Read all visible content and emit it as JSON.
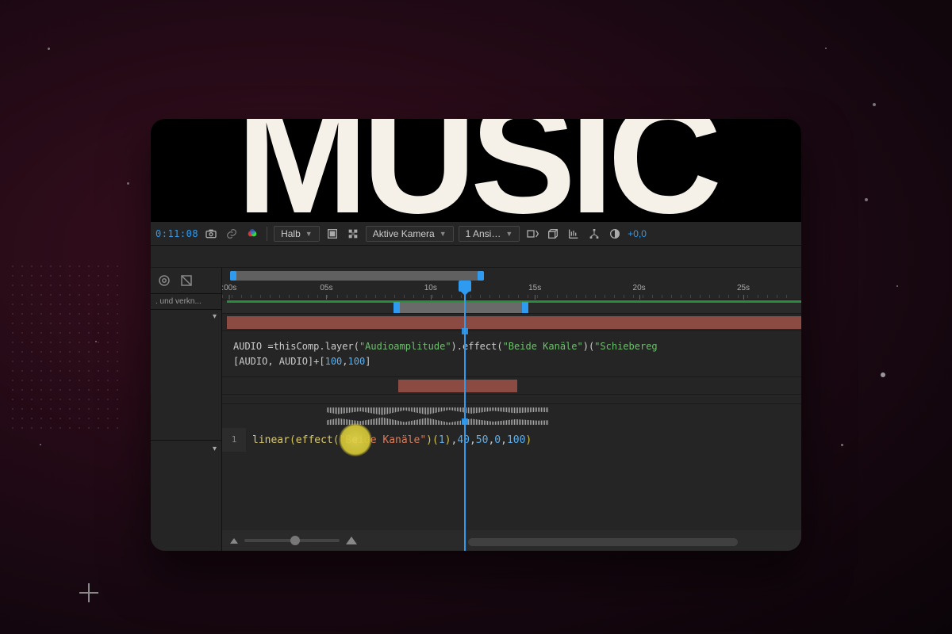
{
  "banner": {
    "title": "MUSIC"
  },
  "toolbar": {
    "timecode": "0:11:08",
    "quality_options_selected": "Halb",
    "camera_selected": "Aktive Kamera",
    "views_selected": "1 Ansi…",
    "exposure": "+0,0"
  },
  "leftcol": {
    "truncated_label": ". und verkn..."
  },
  "ruler": {
    "ticks": [
      {
        "label": ":00s",
        "pct": 1.2
      },
      {
        "label": "05s",
        "pct": 18
      },
      {
        "label": "10s",
        "pct": 36
      },
      {
        "label": "15s",
        "pct": 54
      },
      {
        "label": "20s",
        "pct": 72
      },
      {
        "label": "25s",
        "pct": 90
      }
    ]
  },
  "expression1": {
    "line1_pre": "AUDIO =thisComp.layer(",
    "line1_str1": "\"Audioamplitude\"",
    "line1_mid": ").effect(",
    "line1_str2": "\"Beide Kanäle\"",
    "line1_mid2": ")(",
    "line1_str3": "\"Schiebereg",
    "line2": "[AUDIO, AUDIO]+[",
    "line2_n1": "100",
    "line2_c": ",",
    "line2_n2": "100",
    "line2_end": "]"
  },
  "code": {
    "line_no": "1",
    "tokens": {
      "fn1": "linear",
      "open": "(",
      "fn2": "effect",
      "open2": "(",
      "str": "\"Beide Kanäle\"",
      "close2": ")",
      "open3": "(",
      "arg1": "1",
      "close3": ")",
      "comma1": ",",
      "n1": "40",
      "comma2": ",",
      "n2": "50",
      "comma3": ",",
      "n3": "0",
      "comma4": ",",
      "n4": "100",
      "close": ")"
    }
  }
}
